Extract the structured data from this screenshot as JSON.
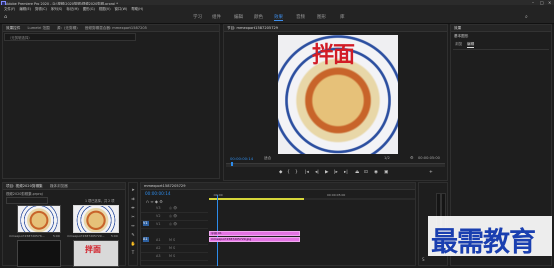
{
  "window": {
    "title": "Adobe Premiere Pro 2020 - D:\\视频\\2020剪辑\\视频2020剪辑.prproj *"
  },
  "menu": [
    "文件(F)",
    "编辑(E)",
    "剪辑(C)",
    "序列(S)",
    "标记(M)",
    "图形(G)",
    "视图(V)",
    "窗口(W)",
    "帮助(H)"
  ],
  "workspaces": [
    "学习",
    "组件",
    "编辑",
    "颜色",
    "效果",
    "音频",
    "图形",
    "库"
  ],
  "workspace_active": "效果",
  "source_panel": {
    "tabs": [
      "效果控件",
      "Lumetri 范围",
      "源：(无剪辑)",
      "音频剪辑混合器: mmexport1587205"
    ],
    "empty_label": "（无剪辑选择）"
  },
  "program_monitor": {
    "tab": "节目: mmexport1587205729",
    "overlay_text": "拌面",
    "timecode": "00:00:00:14",
    "fit": "适合",
    "scale": "1/2",
    "duration": "00:00:05:00"
  },
  "effects_panel": {
    "tabs": [
      "效果"
    ],
    "search_label": "基本图形",
    "subtabs": [
      "浏览",
      "编辑"
    ]
  },
  "project_panel": {
    "tabs": [
      "项目: 视频2020剪辑集",
      "媒体浏览器"
    ],
    "project_name": "视频2020剪辑集.prproj",
    "item_count": "1 项已选择，共 2 项",
    "clips": [
      {
        "label": "mmexport158720576...",
        "duration": "5:00"
      },
      {
        "label": "mmexport1587205729...",
        "duration": "5:00"
      }
    ],
    "bottom_overlay": "拌面"
  },
  "timeline": {
    "tab": "mmexport1587205729",
    "timecode": "00:00:00:14",
    "ruler": [
      ":00:00",
      "00:00:05:00"
    ],
    "tracks": [
      {
        "id": "V3"
      },
      {
        "id": "V2"
      },
      {
        "id": "V1"
      },
      {
        "id": "A1"
      },
      {
        "id": "A2"
      },
      {
        "id": "A3"
      }
    ],
    "clips": [
      {
        "label": "字幕 01"
      },
      {
        "label": "mmexport1587205729.jpg"
      }
    ]
  },
  "watermark": "最需教育",
  "colors": {
    "accent": "#2d8ceb",
    "clip": "#e373e3",
    "panel": "#1e1e1e",
    "watermark": "#1a3fb0"
  }
}
